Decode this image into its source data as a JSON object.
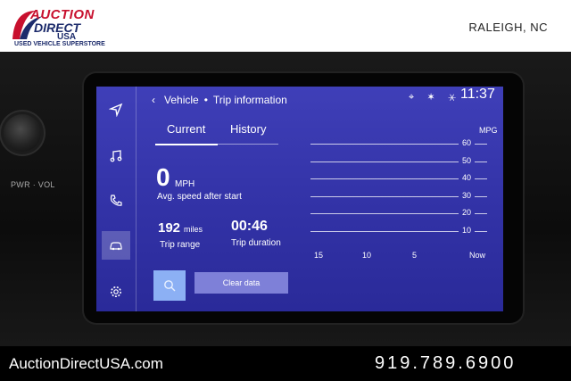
{
  "banner": {
    "logo_auction": "AUCTION",
    "logo_direct": "DIRECT",
    "logo_usa": "USA",
    "logo_tagline": "USED VEHICLE SUPERSTORE",
    "location": "RALEIGH, NC"
  },
  "dash": {
    "knob_label": "PWR · VOL"
  },
  "screen": {
    "breadcrumb": {
      "back": "‹",
      "section": "Vehicle",
      "separator": "•",
      "page": "Trip information"
    },
    "status": {
      "icons": "⌖ ✶ ⚹",
      "time": "11:37"
    },
    "sidebar": [
      {
        "name": "navigation-icon"
      },
      {
        "name": "music-icon"
      },
      {
        "name": "phone-icon"
      },
      {
        "name": "vehicle-icon",
        "active": true
      },
      {
        "name": "settings-icon"
      }
    ],
    "tabs": {
      "current": "Current",
      "history": "History"
    },
    "speed": {
      "value": "0",
      "unit": "MPH",
      "label": "Avg. speed after start"
    },
    "range": {
      "value": "192",
      "unit": "miles",
      "label": "Trip range"
    },
    "duration": {
      "value": "00:46",
      "label": "Trip duration"
    },
    "buttons": {
      "clear": "Clear data"
    }
  },
  "chart_data": {
    "type": "line",
    "ylabel": "MPG",
    "yticks": [
      "60",
      "50",
      "40",
      "30",
      "20",
      "10"
    ],
    "xticks": [
      "15",
      "10",
      "5",
      "Now"
    ],
    "series": []
  },
  "footer": {
    "website": "AuctionDirectUSA.com",
    "phone": "919.789.6900"
  },
  "colors": {
    "screen": "#3a3ab0",
    "brand_red": "#c8102e",
    "brand_blue": "#1c2b6b",
    "clear_button": "#7e80d8",
    "search_button": "#8cb0f4"
  }
}
